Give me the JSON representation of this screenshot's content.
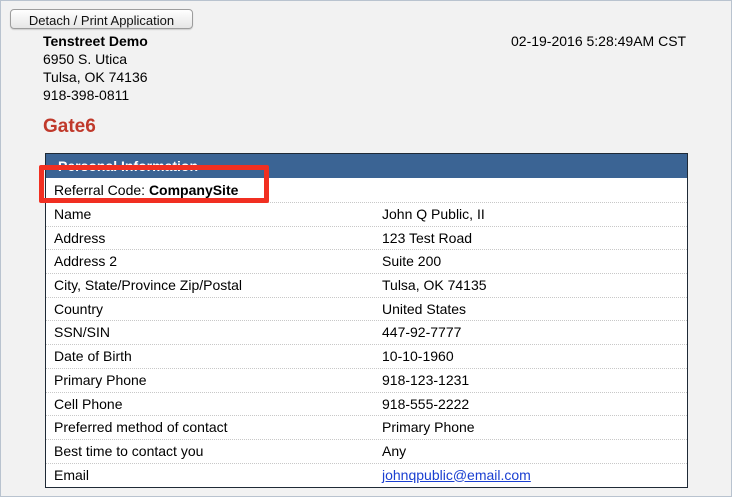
{
  "toolbar": {
    "detach_label": "Detach / Print Application"
  },
  "company": {
    "name": "Tenstreet Demo",
    "address1": "6950 S. Utica",
    "city_line": "Tulsa, OK 74136",
    "phone": "918-398-0811"
  },
  "timestamp": "02-19-2016 5:28:49AM CST",
  "gate_title": "Gate6",
  "section": {
    "header": "Personal Information",
    "referral_label": "Referral Code: ",
    "referral_code": "CompanySite",
    "rows": [
      {
        "label": "Name",
        "value": "John Q Public, II"
      },
      {
        "label": "Address",
        "value": "123 Test Road"
      },
      {
        "label": "Address 2",
        "value": "Suite 200"
      },
      {
        "label": "City, State/Province Zip/Postal",
        "value": "Tulsa, OK 74135"
      },
      {
        "label": "Country",
        "value": "United States"
      },
      {
        "label": "SSN/SIN",
        "value": "447-92-7777"
      },
      {
        "label": "Date of Birth",
        "value": "10-10-1960"
      },
      {
        "label": "Primary Phone",
        "value": "918-123-1231"
      },
      {
        "label": "Cell Phone",
        "value": "918-555-2222"
      },
      {
        "label": "Preferred method of contact",
        "value": "Primary Phone"
      },
      {
        "label": "Best time to contact you",
        "value": "Any"
      },
      {
        "label": "Email",
        "value": "johnqpublic@email.com"
      }
    ]
  },
  "colors": {
    "header_bg": "#3b6494",
    "gate_title": "#c0392b",
    "highlight": "#f12f21",
    "link": "#1a3fd1"
  }
}
